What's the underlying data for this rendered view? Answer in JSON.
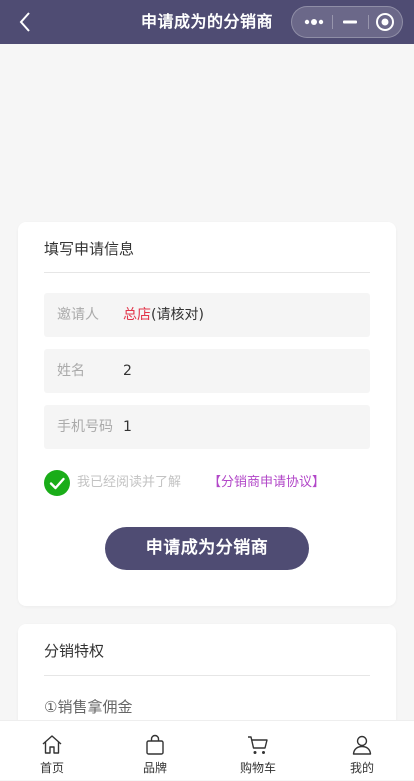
{
  "navbar": {
    "title": "申请成为的分销商",
    "back_icon": "back-arrow-icon",
    "capsule_icons": [
      "more-dots-icon",
      "minimize-icon",
      "close-target-icon"
    ]
  },
  "form": {
    "title": "填写申请信息",
    "fields": [
      {
        "label": "邀请人",
        "value_highlight": "总店",
        "value": "(请核对)"
      },
      {
        "label": "姓名",
        "value": "2"
      },
      {
        "label": "手机号码",
        "value": "1"
      }
    ],
    "agreement": {
      "checked": true,
      "text": "我已经阅读并了解",
      "link": "【分销商申请协议】"
    },
    "submit_label": "申请成为分销商"
  },
  "privileges": {
    "title": "分销特权",
    "items": [
      "①销售拿佣金"
    ]
  },
  "tabbar": {
    "items": [
      {
        "label": "首页",
        "icon": "home-icon"
      },
      {
        "label": "品牌",
        "icon": "bag-icon"
      },
      {
        "label": "购物车",
        "icon": "cart-icon"
      },
      {
        "label": "我的",
        "icon": "user-icon"
      }
    ]
  },
  "colors": {
    "primary": "#4f4c73",
    "highlight": "#e2364b",
    "link": "#b247c8",
    "check": "#1aad19"
  }
}
